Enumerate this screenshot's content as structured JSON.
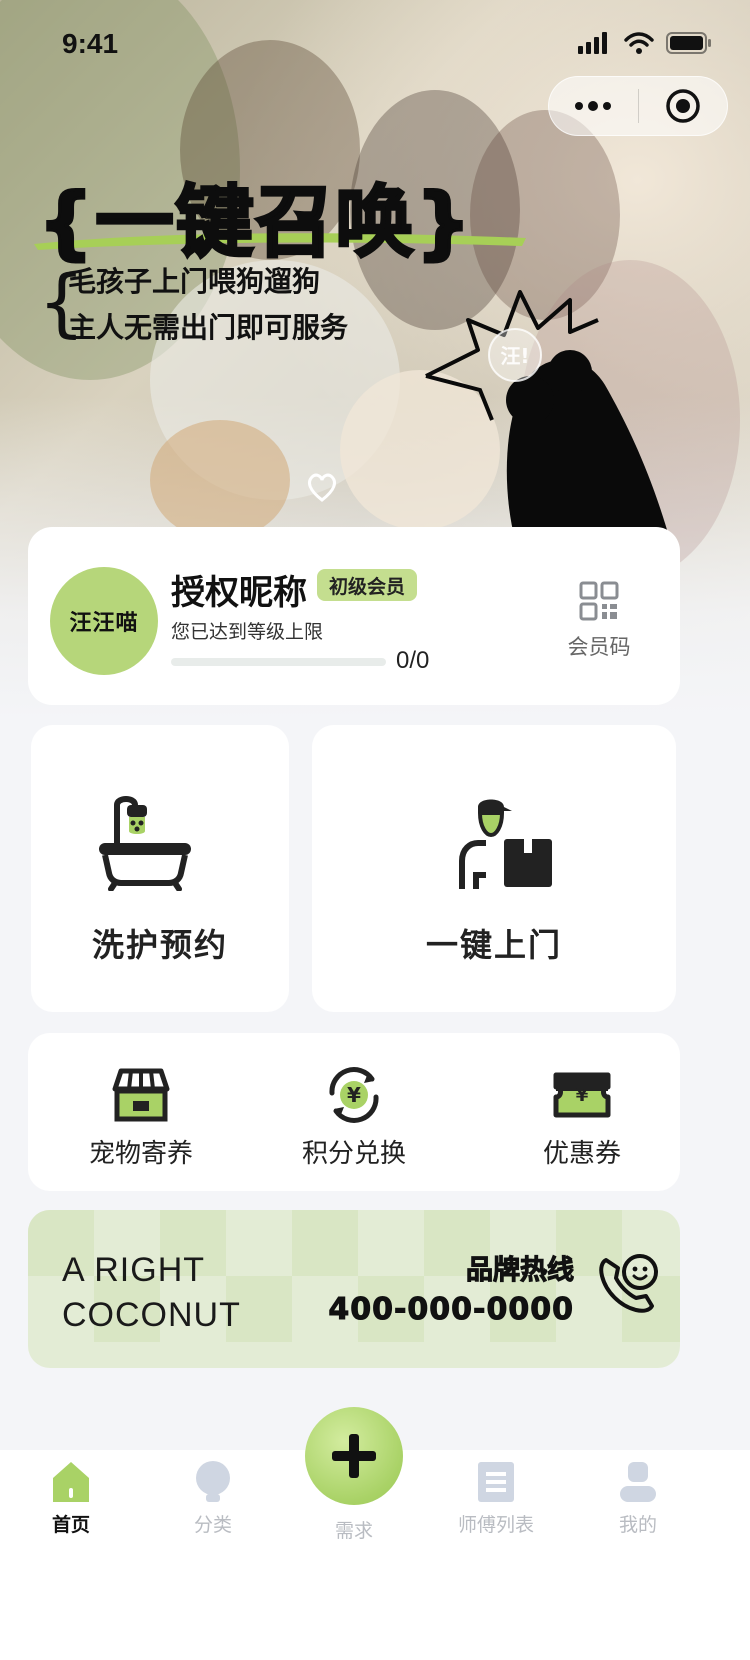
{
  "status_bar": {
    "time": "9:41"
  },
  "hero": {
    "title": "{一键召唤}",
    "subtitle_line1": "毛孩子上门喂狗遛狗",
    "subtitle_line2": "主人无需出门即可服务",
    "sticker_text": "汪!"
  },
  "member": {
    "avatar_text": "汪汪喵",
    "nickname": "授权昵称",
    "level": "初级会员",
    "note": "您已达到等级上限",
    "progress_text": "0/0",
    "progress_value": 0,
    "qr_label": "会员码"
  },
  "services": [
    {
      "label": "洗护预约",
      "icon": "bathtub-icon"
    },
    {
      "label": "一键上门",
      "icon": "delivery-person-icon"
    }
  ],
  "quick": [
    {
      "label": "宠物寄养",
      "icon": "shop-icon"
    },
    {
      "label": "积分兑换",
      "icon": "points-exchange-icon"
    },
    {
      "label": "优惠券",
      "icon": "coupon-icon"
    }
  ],
  "hotline": {
    "brand_line1": "A RIGHT",
    "brand_line2": "COCONUT",
    "title": "品牌热线",
    "number": "400-000-0000"
  },
  "tabbar": {
    "tabs": [
      {
        "label": "首页",
        "icon": "home-icon",
        "active": true
      },
      {
        "label": "分类",
        "icon": "bulb-icon"
      },
      {
        "label": "需求",
        "icon": "plus-icon"
      },
      {
        "label": "师傅列表",
        "icon": "list-icon"
      },
      {
        "label": "我的",
        "icon": "user-icon"
      }
    ]
  },
  "colors": {
    "accent": "#b6d67a",
    "accent_light": "#e3ecd5",
    "background": "#f4f5f8",
    "text": "#1f1f1f",
    "muted": "#b9bcc2"
  }
}
